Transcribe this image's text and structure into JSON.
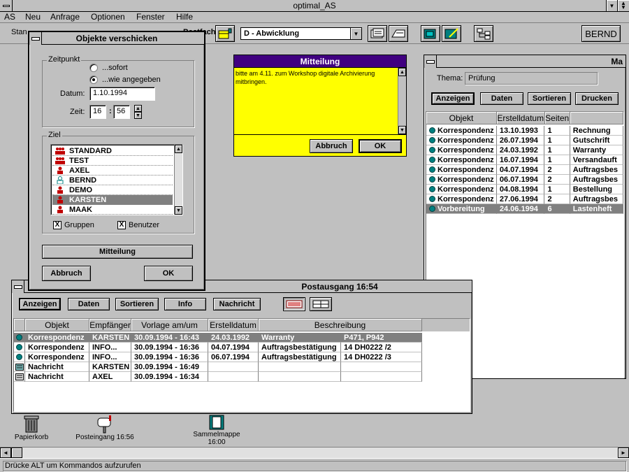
{
  "app": {
    "title": "optimal_AS",
    "menu": [
      "AS",
      "Neu",
      "Anfrage",
      "Optionen",
      "Fenster",
      "Hilfe"
    ],
    "toolbar_label_left": "Stan",
    "toolbar_label_mid": "Postfach:",
    "postfach_select": "D - Abwicklung",
    "user_button": "BERND",
    "status_text": "Drücke ALT um Kommandos aufzurufen"
  },
  "dialog_send": {
    "title": "Objekte verschicken",
    "zeitpunkt_label": "Zeitpunkt",
    "radio_sofort": "...sofort",
    "radio_wie": "...wie angegeben",
    "datum_label": "Datum:",
    "datum_value": "1.10.1994",
    "zeit_label": "Zeit:",
    "zeit_hour": "16",
    "zeit_sep": ":",
    "zeit_min": "56",
    "ziel_label": "Ziel",
    "recipients": [
      {
        "name": "STANDARD",
        "type": "group"
      },
      {
        "name": "TEST",
        "type": "group"
      },
      {
        "name": "AXEL",
        "type": "user"
      },
      {
        "name": "BERND",
        "type": "user-outline"
      },
      {
        "name": "DEMO",
        "type": "user"
      },
      {
        "name": "KARSTEN",
        "type": "user",
        "selected": true
      },
      {
        "name": "MAAK",
        "type": "user"
      }
    ],
    "check_gruppen": "Gruppen",
    "check_benutzer": "Benutzer",
    "check_mark": "X",
    "mitteilung_button": "Mitteilung",
    "abbruch_button": "Abbruch",
    "ok_button": "OK"
  },
  "dialog_message": {
    "title": "Mitteilung",
    "text": "bitte am 4.11. zum Workshop digitale Archivierung mitbringen.",
    "abbruch_button": "Abbruch",
    "ok_button": "OK"
  },
  "window_mappe": {
    "title": "Ma",
    "thema_label": "Thema:",
    "thema_value": "Prüfung",
    "buttons": [
      "Anzeigen",
      "Daten",
      "Sortieren",
      "Drucken"
    ],
    "columns": [
      "Objekt",
      "Erstelldatum",
      "Seiten",
      ""
    ],
    "rows": [
      [
        "Korrespondenz",
        "13.10.1993",
        "1",
        "Rechnung"
      ],
      [
        "Korrespondenz",
        "26.07.1994",
        "1",
        "Gutschrift"
      ],
      [
        "Korrespondenz",
        "24.03.1992",
        "1",
        "Warranty"
      ],
      [
        "Korrespondenz",
        "16.07.1994",
        "1",
        "Versandauft"
      ],
      [
        "Korrespondenz",
        "04.07.1994",
        "2",
        "Auftragsbes"
      ],
      [
        "Korrespondenz",
        "06.07.1994",
        "2",
        "Auftragsbes"
      ],
      [
        "Korrespondenz",
        "04.08.1994",
        "1",
        "Bestellung"
      ],
      [
        "Korrespondenz",
        "27.06.1994",
        "2",
        "Auftragsbes"
      ],
      [
        "Vorbereitung",
        "24.06.1994",
        "6",
        "Lastenheft"
      ]
    ]
  },
  "window_postausgang": {
    "title": "Postausgang 16:54",
    "buttons": [
      "Anzeigen",
      "Daten",
      "Sortieren",
      "Info",
      "Nachricht"
    ],
    "columns": [
      "Objekt",
      "Empfänger",
      "Vorlage am/um",
      "Erstelldatum",
      "Beschreibung"
    ],
    "rows": [
      {
        "icon": "dot",
        "cells": [
          "Korrespondenz",
          "KARSTEN",
          "30.09.1994 - 16:43",
          "24.03.1992",
          "Warranty",
          "P471, P942"
        ]
      },
      {
        "icon": "dot",
        "cells": [
          "Korrespondenz",
          "INFO...",
          "30.09.1994 - 16:36",
          "04.07.1994",
          "Auftragsbestätigung",
          "14 DH0222 /2"
        ]
      },
      {
        "icon": "dot",
        "cells": [
          "Korrespondenz",
          "INFO...",
          "30.09.1994 - 16:36",
          "06.07.1994",
          "Auftragsbestätigung",
          "14 DH0222 /3"
        ]
      },
      {
        "icon": "note",
        "cells": [
          "Nachricht",
          "KARSTEN",
          "30.09.1994 - 16:49",
          "",
          "",
          ""
        ]
      },
      {
        "icon": "note2",
        "cells": [
          "Nachricht",
          "AXEL",
          "30.09.1994 - 16:34",
          "",
          "",
          ""
        ]
      }
    ]
  },
  "desktop_icons": {
    "papierkorb": "Papierkorb",
    "posteingang": "Posteingang 16:56",
    "sammelmappe": "Sammelmappe",
    "sammelmappe_time": "16:00"
  }
}
